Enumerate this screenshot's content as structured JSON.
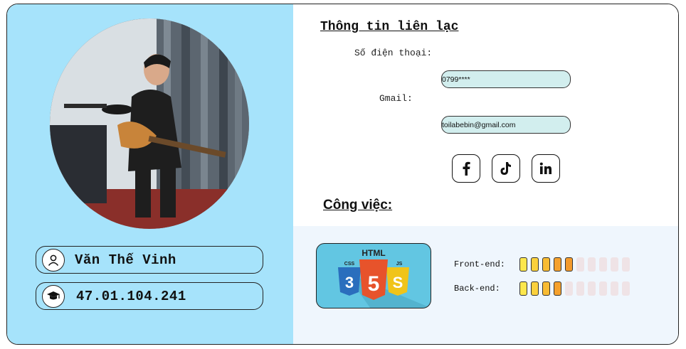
{
  "profile": {
    "name": "Văn Thế Vinh",
    "student_id": "47.01.104.241",
    "name_icon": "user-icon",
    "id_icon": "graduation-cap-icon"
  },
  "contact": {
    "heading": "Thông tin liên lạc",
    "phone_label": "Số điện thoại:",
    "phone_value": "0799****",
    "gmail_label": "Gmail:",
    "gmail_value": "toilabebin@gmail.com",
    "social": [
      "facebook-icon",
      "tiktok-icon",
      "linkedin-icon"
    ]
  },
  "job": {
    "heading": "Công việc:",
    "logo_text": {
      "html": "HTML",
      "css": "CSS",
      "js": "JS"
    },
    "skills": [
      {
        "label": "Front-end:",
        "level": 5,
        "max": 10,
        "colors": [
          "#fde74c",
          "#fbd13d",
          "#f8bb32",
          "#f5a12d",
          "#f39a2c"
        ]
      },
      {
        "label": "Back-end:",
        "level": 4,
        "max": 10,
        "colors": [
          "#fde74c",
          "#fbd13d",
          "#f8bb32",
          "#f5a12d"
        ]
      }
    ]
  },
  "colors": {
    "left_panel": "#a6e3fb",
    "field_bg": "#d2eeee",
    "bottom_panel": "#eff6fd"
  }
}
